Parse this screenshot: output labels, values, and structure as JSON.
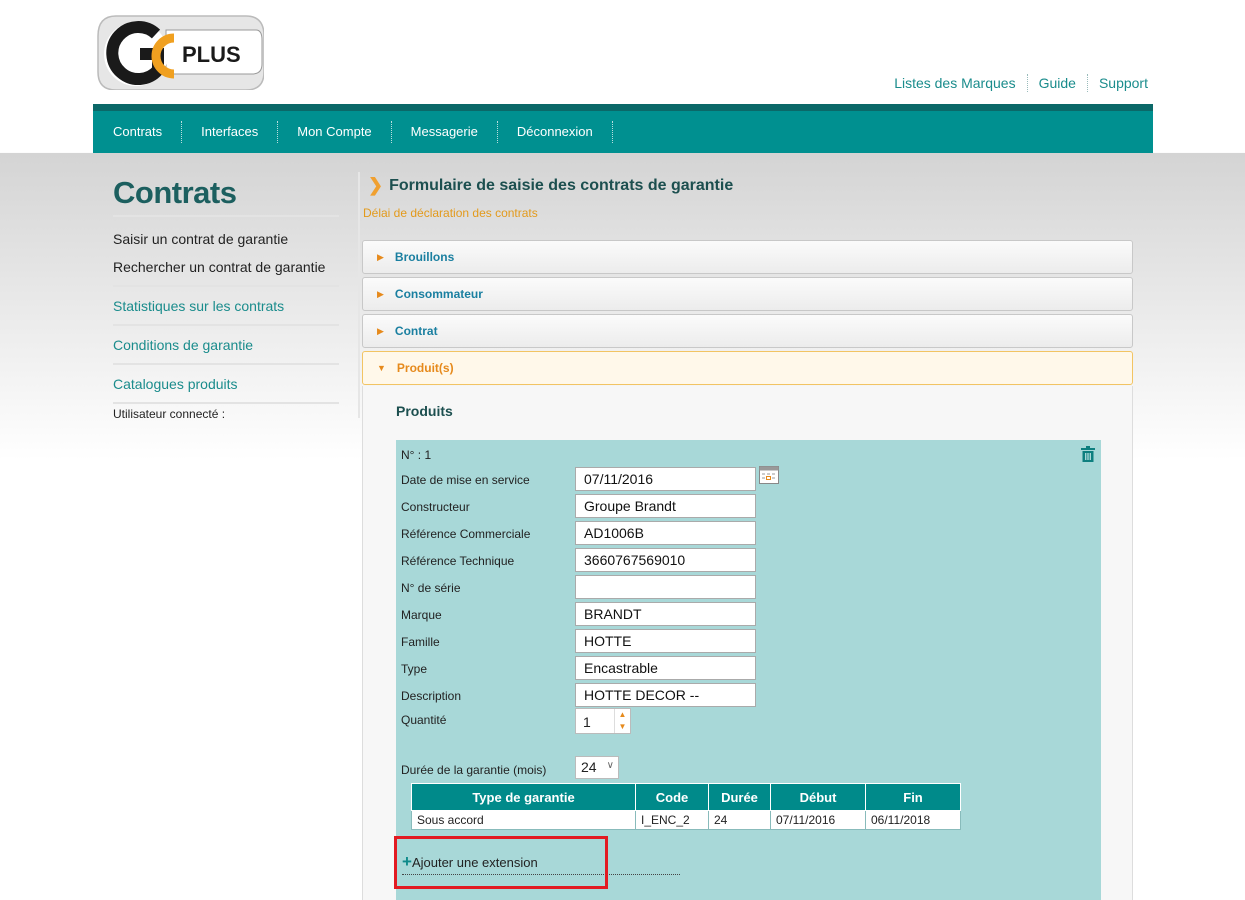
{
  "logo": {
    "text": "PLUS"
  },
  "toplinks": [
    "Listes des Marques",
    "Guide",
    "Support"
  ],
  "nav": [
    "Contrats",
    "Interfaces",
    "Mon Compte",
    "Messagerie",
    "Déconnexion"
  ],
  "sidebar": {
    "title": "Contrats",
    "sub_items": [
      "Saisir un contrat de garantie",
      "Rechercher un contrat de garantie"
    ],
    "links": [
      "Statistiques sur les contrats",
      "Conditions de garantie",
      "Catalogues produits"
    ],
    "user_label": "Utilisateur connecté :"
  },
  "main": {
    "title": "Formulaire de saisie des contrats de garantie",
    "delai": "Délai de déclaration des contrats",
    "sections": [
      "Brouillons",
      "Consommateur",
      "Contrat",
      "Produit(s)"
    ],
    "produits_heading": "Produits"
  },
  "product": {
    "num_label": "N° : 1",
    "fields": [
      {
        "label": "Date de mise en service",
        "value": "07/11/2016"
      },
      {
        "label": "Constructeur",
        "value": "Groupe Brandt"
      },
      {
        "label": "Référence Commerciale",
        "value": "AD1006B"
      },
      {
        "label": "Référence Technique",
        "value": "3660767569010"
      },
      {
        "label": "N° de série",
        "value": ""
      },
      {
        "label": "Marque",
        "value": "BRANDT"
      },
      {
        "label": "Famille",
        "value": "HOTTE"
      },
      {
        "label": "Type",
        "value": "Encastrable"
      },
      {
        "label": "Description",
        "value": "HOTTE DECOR --"
      }
    ],
    "quantite_label": "Quantité",
    "quantite_value": "1",
    "duree_label": "Durée de la garantie (mois)",
    "duree_value": "24",
    "table": {
      "headers": [
        "Type de garantie",
        "Code",
        "Durée",
        "Début",
        "Fin"
      ],
      "rows": [
        [
          "Sous accord",
          "I_ENC_2",
          "24",
          "07/11/2016",
          "06/11/2018"
        ]
      ]
    },
    "extension_label": "Ajouter une extension"
  },
  "colors": {
    "teal": "#009090",
    "orange": "#e68a1c",
    "highlight": "#e21b22"
  }
}
